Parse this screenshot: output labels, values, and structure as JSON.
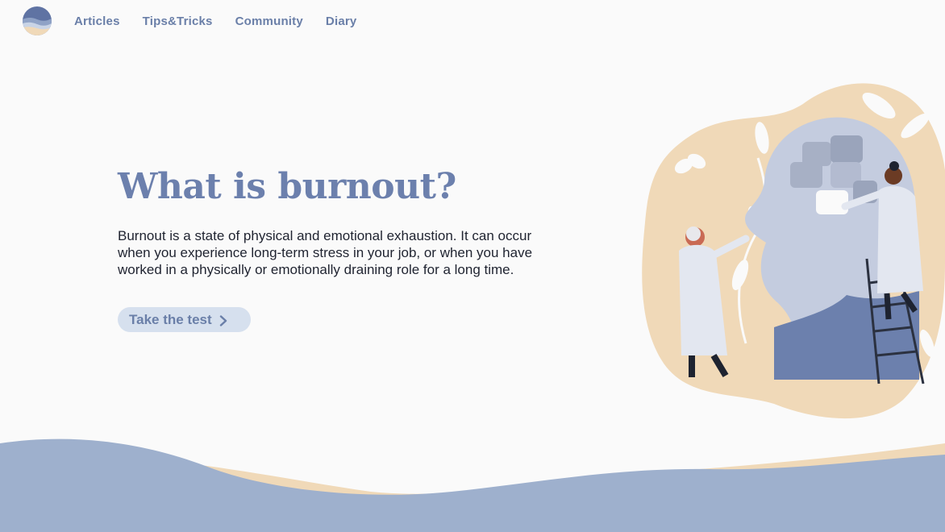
{
  "nav": {
    "items": [
      {
        "label": "Articles"
      },
      {
        "label": "Tips&Tricks"
      },
      {
        "label": "Community"
      },
      {
        "label": "Diary"
      }
    ]
  },
  "hero": {
    "title": "What is burnout?",
    "body": "Burnout is a state of physical and emotional exhaustion. It can occur when you experience long-term stress in your job, or when you have worked in a physically or emotionally draining role for a long time.",
    "cta_label": "Take the test",
    "cta_icon": "chevron-right-icon"
  },
  "colors": {
    "background": "#fafafa",
    "accent": "#6c80ad",
    "button_bg": "#d6e0ee",
    "sand": "#f0d9b8",
    "wave_blue": "#9eb0cd"
  }
}
